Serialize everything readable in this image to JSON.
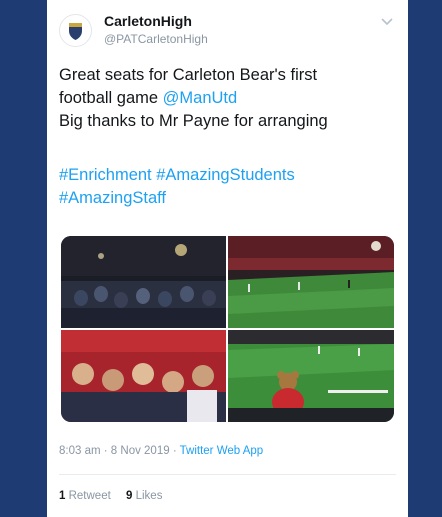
{
  "account": {
    "display_name": "CarletonHigh",
    "handle": "@PATCarletonHigh",
    "avatar_icon": "school-crest-icon",
    "menu_icon": "chevron-down-icon"
  },
  "tweet": {
    "text_line1": "Great seats for Carleton Bear's first",
    "text_line2_prefix": "football game ",
    "mention": "@ManUtd",
    "text_line3": "Big thanks to Mr Payne for arranging",
    "hashtags": [
      "#Enrichment",
      "#AmazingStudents",
      "#AmazingStaff"
    ]
  },
  "media": {
    "photos": [
      {
        "name": "crowd-outside-stadium-photo"
      },
      {
        "name": "stadium-pitch-photo"
      },
      {
        "name": "students-in-stands-photo"
      },
      {
        "name": "teddy-bear-at-match-photo"
      }
    ]
  },
  "meta": {
    "time": "8:03 am",
    "separator": " · ",
    "date": "8 Nov 2019",
    "source": "Twitter Web App"
  },
  "stats": {
    "retweets_count": "1",
    "retweets_label": "Retweet",
    "likes_count": "9",
    "likes_label": "Likes"
  },
  "colors": {
    "frame": "#1f3b73",
    "link": "#1da1f2",
    "text": "#14171a",
    "muted": "#8a96a3"
  }
}
